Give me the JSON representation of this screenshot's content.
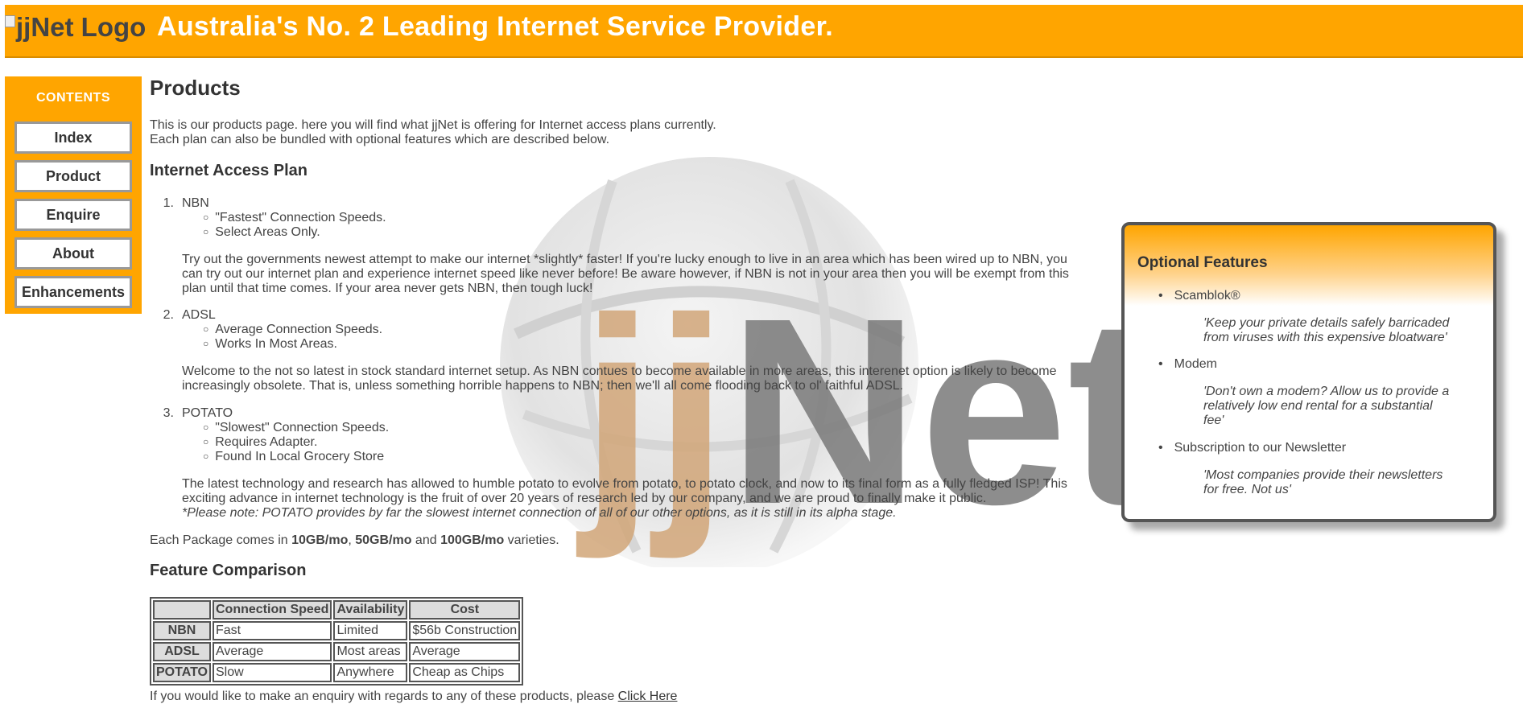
{
  "header": {
    "logo_alt": "jjNet Logo",
    "title": "Australia's No. 2 Leading Internet Service Provider."
  },
  "sidebar": {
    "title": "CONTENTS",
    "items": [
      {
        "label": "Index"
      },
      {
        "label": "Product"
      },
      {
        "label": "Enquire"
      },
      {
        "label": "About"
      },
      {
        "label": "Enhancements"
      }
    ]
  },
  "main": {
    "title": "Products",
    "intro": [
      "This is our products page. here you will find what jjNet is offering for Internet access plans currently.",
      "Each plan can also be bundled with optional features which are described below."
    ],
    "plans_heading": "Internet Access Plan",
    "plans": [
      {
        "number": "1.",
        "name": "NBN",
        "features": [
          "\"Fastest\" Connection Speeds.",
          "Select Areas Only."
        ],
        "description": "Try out the governments newest attempt to make our internet *slightly* faster! If you're lucky enough to live in an area which has been wired up to NBN, you can try out our internet plan and experience internet speed like never before! Be aware however, if NBN is not in your area then you will be exempt from this plan until that time comes. If your area never gets NBN, then tough luck!"
      },
      {
        "number": "2.",
        "name": "ADSL",
        "features": [
          "Average Connection Speeds.",
          "Works In Most Areas."
        ],
        "description": "Welcome to the not so latest in stock standard internet setup. As NBN contues to become available in more areas, this interenet option is likely to become increasingly obsolete. That is, unless something horrible happens to NBN; then we'll all come flooding back to ol' faithful ADSL."
      },
      {
        "number": "3.",
        "name": "POTATO",
        "features": [
          "\"Slowest\" Connection Speeds.",
          "Requires Adapter.",
          "Found In Local Grocery Store"
        ],
        "description": "The latest technology and research has allowed to humble potato to evolve from potato, to potato clock, and now to its final form as a fully fledged ISP! This exciting advance in internet technology is the fruit of over 20 years of research led by our company, and we are proud to finally make it public.",
        "note": "*Please note: POTATO provides by far the slowest internet connection of all of our other options, as it is still in its alpha stage."
      }
    ],
    "package": {
      "prefix": "Each Package comes in ",
      "size1": "10GB/mo",
      "sep1": ", ",
      "size2": "50GB/mo",
      "sep2": " and ",
      "size3": "100GB/mo",
      "suffix": " varieties."
    },
    "comparison_heading": "Feature Comparison",
    "table": {
      "headers": [
        "",
        "Connection Speed",
        "Availability",
        "Cost"
      ],
      "rows": [
        [
          "NBN",
          "Fast",
          "Limited",
          "$56b Construction"
        ],
        [
          "ADSL",
          "Average",
          "Most areas",
          "Average"
        ],
        [
          "POTATO",
          "Slow",
          "Anywhere",
          "Cheap as Chips"
        ]
      ]
    },
    "enquiry": {
      "text": "If you would like to make an enquiry with regards to any of these products, please ",
      "link": "Click Here"
    },
    "watermark_text": "jjNet"
  },
  "aside": {
    "title": "Optional Features",
    "features": [
      {
        "name": "Scamblok®",
        "quote": "'Keep your private details safely barricaded from viruses with this expensive bloatware'"
      },
      {
        "name": "Modem",
        "quote": "'Don't own a modem? Allow us to provide a relatively low end rental for a substantial fee'"
      },
      {
        "name": "Subscription to our Newsletter",
        "quote": "'Most companies provide their newsletters for free. Not us'"
      }
    ]
  },
  "colors": {
    "accent": "#ffa500",
    "nav_border": "#999999",
    "text": "#444444",
    "watermark_j": "#d2a679",
    "watermark_net": "#7a7a7a"
  }
}
